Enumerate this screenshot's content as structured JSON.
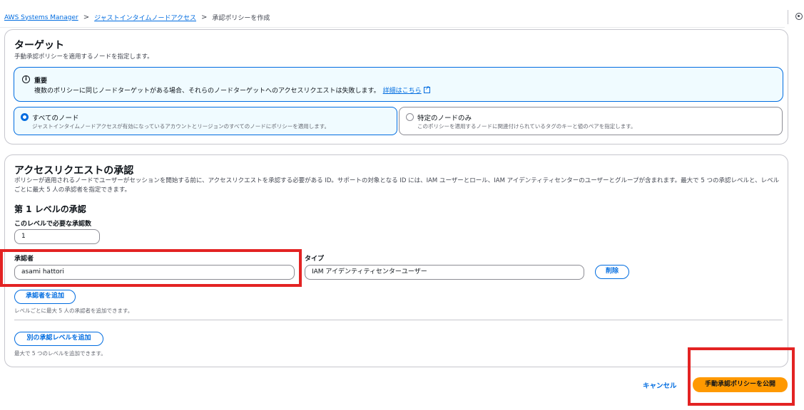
{
  "breadcrumb": {
    "root": "AWS Systems Manager",
    "parent": "ジャストインタイムノードアクセス",
    "current": "承認ポリシーを作成",
    "separator": ">"
  },
  "target": {
    "title": "ターゲット",
    "description": "手動承認ポリシーを適用するノードを指定します。",
    "alert": {
      "icon": "info-icon",
      "title": "重要",
      "text": "複数のポリシーに同じノードターゲットがある場合、それらのノードターゲットへのアクセスリクエストは失敗します。",
      "link": "詳細はこちら"
    },
    "options": [
      {
        "label": "すべてのノード",
        "description": "ジャストインタイムノードアクセスが有効になっているアカウントとリージョンのすべてのノードにポリシーを適用します。",
        "selected": true
      },
      {
        "label": "特定のノードのみ",
        "description": "このポリシーを適用するノードに関連付けられているタグのキーと値のペアを指定します。",
        "selected": false
      }
    ]
  },
  "approval": {
    "title": "アクセスリクエストの承認",
    "description": "ポリシーが適用されるノードでユーザーがセッションを開始する前に、アクセスリクエストを承認する必要がある ID。サポートの対象となる ID には、IAM ユーザーとロール、IAM アイデンティティセンターのユーザーとグループが含まれます。最大で 5 つの承認レベルと、レベルごとに最大 5 人の承認者を指定できます。",
    "level_title": "第 1 レベルの承認",
    "required_label": "このレベルで必要な承認数",
    "required_value": "1",
    "approver_label": "承認者",
    "approver_value": "asami hattori",
    "type_label": "タイプ",
    "type_value": "IAM アイデンティティセンターユーザー",
    "remove_button": "削除",
    "add_approver_button": "承認者を追加",
    "add_approver_hint": "レベルごとに最大 5 人の承認者を追加できます。",
    "add_level_button": "別の承認レベルを追加",
    "add_level_hint": "最大で 5 つのレベルを追加できます。"
  },
  "footer": {
    "cancel": "キャンセル",
    "submit": "手動承認ポリシーを公開"
  },
  "colors": {
    "link_blue": "#006ce0",
    "primary_orange": "#ff9900",
    "highlight_red": "#e32323",
    "alert_bg": "#f0fbff"
  }
}
